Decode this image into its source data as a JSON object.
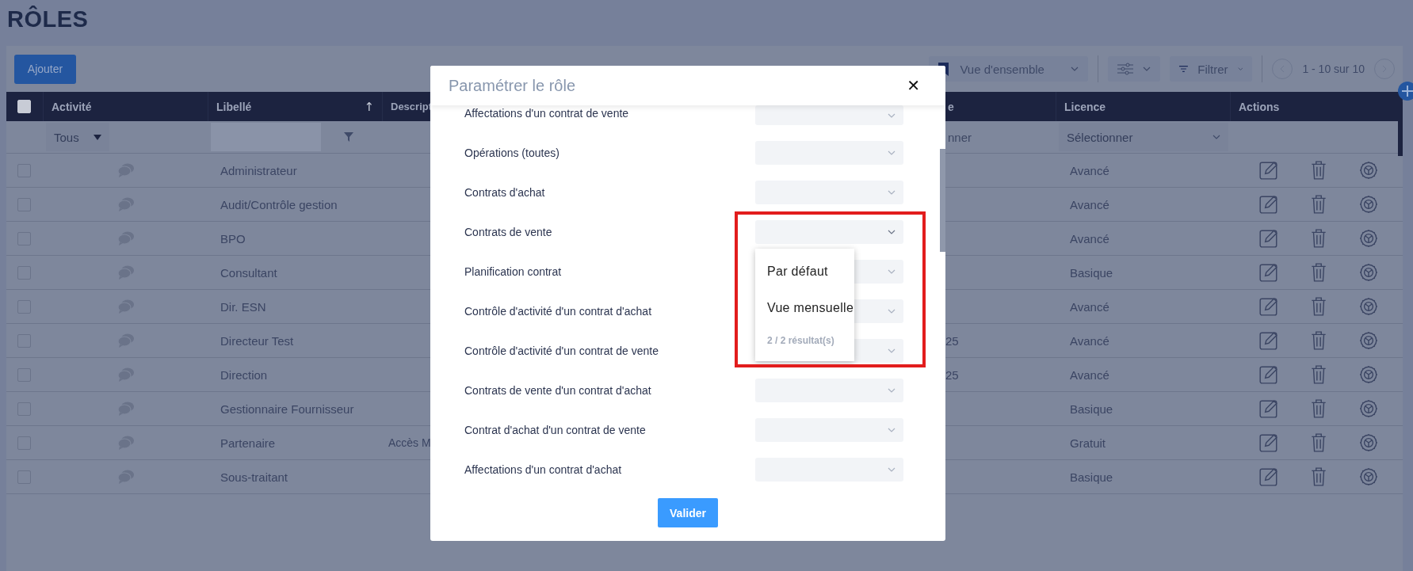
{
  "page_title": "RÔLES",
  "toolbar": {
    "add_button": "Ajouter",
    "view_select": "Vue d'ensemble",
    "filter_button": "Filtrer",
    "pagination": "1 - 10 sur 10"
  },
  "table": {
    "select_all_checked": false,
    "columns": [
      {
        "label": "Activité"
      },
      {
        "label": "Libellé",
        "sort": "↑"
      },
      {
        "label": "Descript"
      },
      {
        "label": "e"
      },
      {
        "label": "Licence"
      },
      {
        "label": "Actions"
      }
    ],
    "filters": {
      "activity": "Tous",
      "column_4": "nner",
      "licence": "Sélectionner"
    },
    "rows": [
      {
        "checked": false,
        "label": "Administrateur",
        "licence": "Avancé"
      },
      {
        "checked": false,
        "label": "Audit/Contrôle gestion",
        "licence": "Avancé"
      },
      {
        "checked": false,
        "label": "BPO",
        "licence": "Avancé"
      },
      {
        "checked": false,
        "label": "Consultant",
        "licence": "Basique"
      },
      {
        "checked": false,
        "label": "Dir. ESN",
        "licence": "Avancé"
      },
      {
        "checked": false,
        "label": "Directeur Test",
        "column_4": "25",
        "licence": "Avancé"
      },
      {
        "checked": false,
        "label": "Direction",
        "column_4": "25",
        "licence": "Avancé"
      },
      {
        "checked": false,
        "label": "Gestionnaire Fournisseur",
        "licence": "Basique"
      },
      {
        "checked": false,
        "label": "Partenaire",
        "description": "Accès M",
        "licence": "Gratuit"
      },
      {
        "checked": false,
        "label": "Sous-traitant",
        "licence": "Basique"
      }
    ]
  },
  "modal": {
    "title": "Paramétrer le rôle",
    "close": "✕",
    "rows": [
      {
        "label": "Affectations d'un contrat de vente",
        "open": false
      },
      {
        "label": "Opérations (toutes)",
        "open": false
      },
      {
        "label": "Contrats d'achat",
        "open": false
      },
      {
        "label": "Contrats de vente",
        "open": true
      },
      {
        "label": "Planification contrat",
        "open": false
      },
      {
        "label": "Contrôle d'activité d'un contrat d'achat",
        "open": false
      },
      {
        "label": "Contrôle d'activité d'un contrat de vente",
        "open": false
      },
      {
        "label": "Contrats de vente d'un contrat d'achat",
        "open": false
      },
      {
        "label": "Contrat d'achat d'un contrat de vente",
        "open": false
      },
      {
        "label": "Affectations d'un contrat d'achat",
        "open": false
      }
    ],
    "dropdown": {
      "options": [
        "Par défaut",
        "Vue mensuelle"
      ],
      "count": "2 / 2 résultat(s)"
    },
    "submit": "Valider"
  }
}
